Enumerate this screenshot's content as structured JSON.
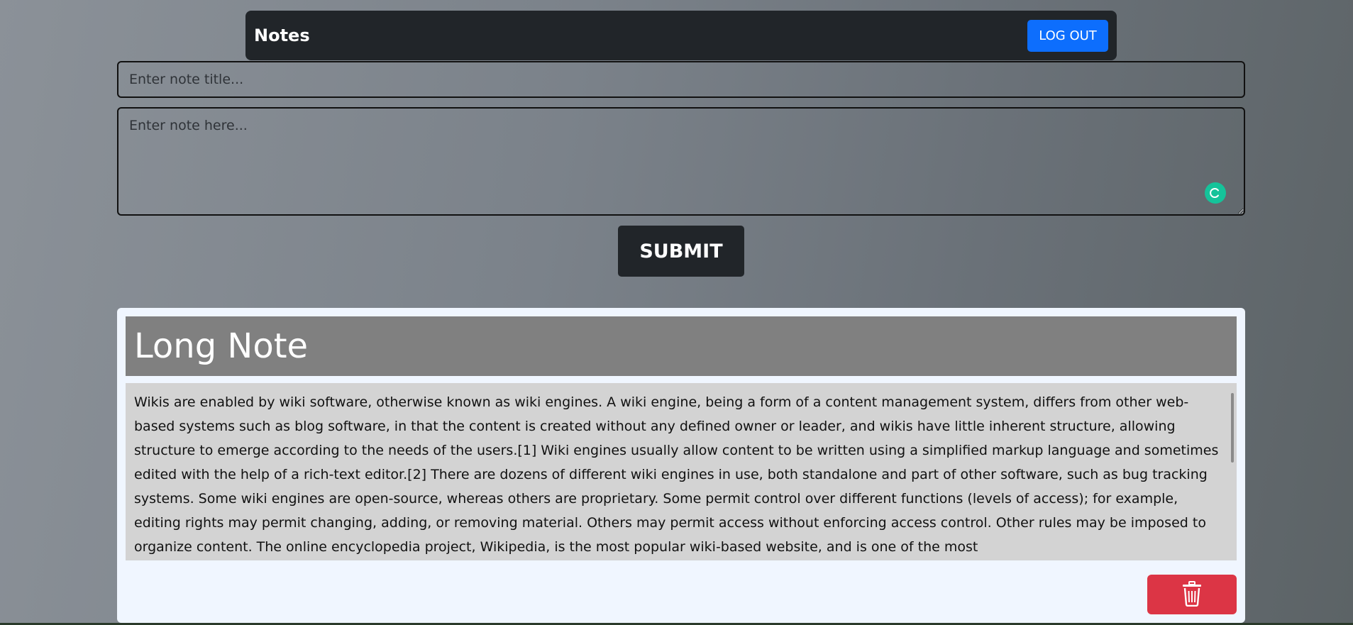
{
  "navbar": {
    "brand": "Notes",
    "logout_label": "LOG OUT"
  },
  "form": {
    "title_placeholder": "Enter note title...",
    "title_value": "",
    "body_placeholder": "Enter note here...",
    "body_value": "",
    "submit_label": "SUBMIT",
    "assist_icon": "grammar-assistant-icon"
  },
  "notes": [
    {
      "title": "Long Note",
      "body": "Wikis are enabled by wiki software, otherwise known as wiki engines. A wiki engine, being a form of a content management system, differs from other web-based systems such as blog software, in that the content is created without any defined owner or leader, and wikis have little inherent structure, allowing structure to emerge according to the needs of the users.[1] Wiki engines usually allow content to be written using a simplified markup language and sometimes edited with the help of a rich-text editor.[2] There are dozens of different wiki engines in use, both standalone and part of other software, such as bug tracking systems. Some wiki engines are open-source, whereas others are proprietary. Some permit control over different functions (levels of access); for example, editing rights may permit changing, adding, or removing material. Others may permit access without enforcing access control. Other rules may be imposed to organize content. The online encyclopedia project, Wikipedia, is the most popular wiki-based website, and is one of the most",
      "delete_icon": "trash-icon"
    }
  ],
  "colors": {
    "navbar_bg": "#212529",
    "primary": "#0d6efd",
    "danger": "#dc3545",
    "card_bg": "#f0f6ff",
    "note_title_bg": "#808080",
    "note_body_bg": "#d3d3d3",
    "assist": "#15c39a"
  }
}
